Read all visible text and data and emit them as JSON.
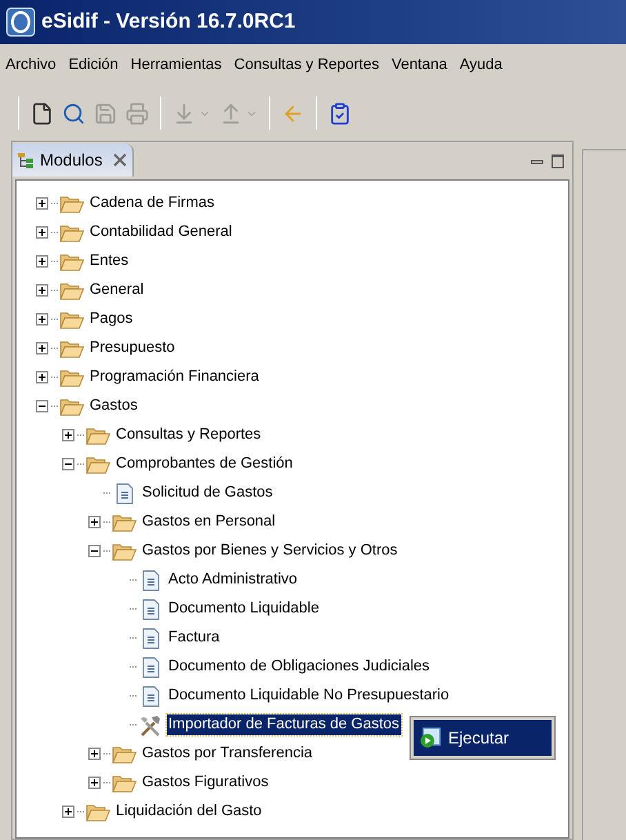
{
  "window": {
    "title": "eSidif - Versión 16.7.0RC1"
  },
  "menu": [
    "Archivo",
    "Edición",
    "Herramientas",
    "Consultas y Reportes",
    "Ventana",
    "Ayuda"
  ],
  "toolbar": {
    "groups": [
      [
        {
          "disabled": false,
          "dropdown": false
        },
        {
          "disabled": false,
          "dropdown": false
        },
        {
          "disabled": true,
          "dropdown": false
        },
        {
          "disabled": true,
          "dropdown": false
        }
      ],
      [
        {
          "disabled": true,
          "dropdown": true
        },
        {
          "disabled": true,
          "dropdown": true
        }
      ],
      [
        {
          "disabled": false,
          "dropdown": false
        }
      ],
      [
        {
          "disabled": false,
          "dropdown": false
        }
      ]
    ]
  },
  "view": {
    "tab": {
      "label": "Modulos",
      "selected": true
    },
    "tree": [
      {
        "kind": "folder",
        "label": "Cadena de Firmas",
        "expanded": false,
        "selected": false
      },
      {
        "kind": "folder",
        "label": "Contabilidad General",
        "expanded": false,
        "selected": false
      },
      {
        "kind": "folder",
        "label": "Entes",
        "expanded": false,
        "selected": false
      },
      {
        "kind": "folder",
        "label": "General",
        "expanded": false,
        "selected": false
      },
      {
        "kind": "folder",
        "label": "Pagos",
        "expanded": false,
        "selected": false
      },
      {
        "kind": "folder",
        "label": "Presupuesto",
        "expanded": false,
        "selected": false
      },
      {
        "kind": "folder",
        "label": "Programación Financiera",
        "expanded": false,
        "selected": false
      },
      {
        "kind": "folder",
        "label": "Gastos",
        "expanded": true,
        "selected": false,
        "children": [
          {
            "kind": "folder",
            "label": "Consultas y Reportes",
            "expanded": false,
            "selected": false
          },
          {
            "kind": "folder",
            "label": "Comprobantes de Gestión",
            "expanded": true,
            "selected": false,
            "children": [
              {
                "kind": "document",
                "label": "Solicitud de Gastos",
                "selected": false
              },
              {
                "kind": "folder",
                "label": "Gastos en Personal",
                "expanded": false,
                "selected": false
              },
              {
                "kind": "folder",
                "label": "Gastos por Bienes y Servicios y Otros",
                "expanded": true,
                "selected": false,
                "children": [
                  {
                    "kind": "document",
                    "label": "Acto Administrativo",
                    "selected": false
                  },
                  {
                    "kind": "document",
                    "label": "Documento Liquidable",
                    "selected": false
                  },
                  {
                    "kind": "document",
                    "label": "Factura",
                    "selected": false
                  },
                  {
                    "kind": "document",
                    "label": "Documento de Obligaciones Judiciales",
                    "selected": false
                  },
                  {
                    "kind": "document",
                    "label": "Documento Liquidable No Presupuestario",
                    "selected": false
                  },
                  {
                    "kind": "tool",
                    "label": "Importador de Facturas de Gastos",
                    "selected": true
                  }
                ]
              },
              {
                "kind": "folder",
                "label": "Gastos por Transferencia",
                "expanded": false,
                "selected": false
              },
              {
                "kind": "folder",
                "label": "Gastos Figurativos",
                "expanded": false,
                "selected": false
              }
            ]
          },
          {
            "kind": "folder",
            "label": "Liquidación del Gasto",
            "expanded": false,
            "selected": false
          }
        ]
      }
    ]
  },
  "context_menu": {
    "items": [
      {
        "label": "Ejecutar",
        "selected": true
      }
    ]
  }
}
